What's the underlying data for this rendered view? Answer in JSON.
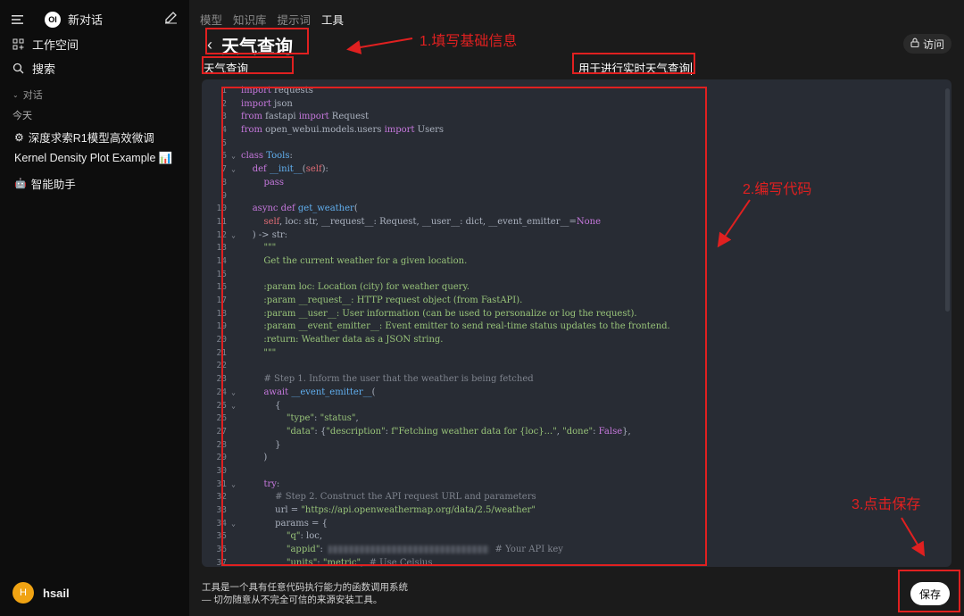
{
  "sidebar": {
    "new_chat": "新对话",
    "workspace": "工作空间",
    "search": "搜索",
    "section_chats": "对话",
    "section_today": "今天",
    "chats": [
      {
        "label": "深度求索R1模型高效微调",
        "icon": "gear-icon"
      },
      {
        "label": "Kernel Density Plot Example 📊",
        "icon": ""
      },
      {
        "label": "智能助手",
        "icon": "robot-icon"
      }
    ],
    "user": {
      "initial": "H",
      "name": "hsail"
    }
  },
  "tabs": [
    {
      "label": "模型",
      "active": false
    },
    {
      "label": "知识库",
      "active": false
    },
    {
      "label": "提示词",
      "active": false
    },
    {
      "label": "工具",
      "active": true
    }
  ],
  "header": {
    "title": "天气查询",
    "access_label": "访问"
  },
  "form": {
    "name": "天气查询",
    "description": "用于进行实时天气查询"
  },
  "editor": {
    "line_numbers": [
      "1",
      "2",
      "3",
      "4",
      "5",
      "6",
      "7",
      "8",
      "9",
      "10",
      "11",
      "12",
      "13",
      "14",
      "15",
      "16",
      "17",
      "18",
      "19",
      "20",
      "21",
      "22",
      "23",
      "24",
      "25",
      "26",
      "27",
      "28",
      "29",
      "30",
      "31",
      "32",
      "33",
      "34",
      "35",
      "36",
      "37"
    ],
    "fold_lines": [
      6,
      7,
      12,
      24,
      25,
      31,
      34
    ]
  },
  "footer": {
    "notice_line1": "工具是一个具有任意代码执行能力的函数调用系统",
    "notice_line2": "— 切勿随意从不完全可信的来源安装工具。",
    "save_label": "保存"
  },
  "annotations": {
    "step1": "1.填写基础信息",
    "step2": "2.编写代码",
    "step3": "3.点击保存",
    "color": "#e02020"
  }
}
